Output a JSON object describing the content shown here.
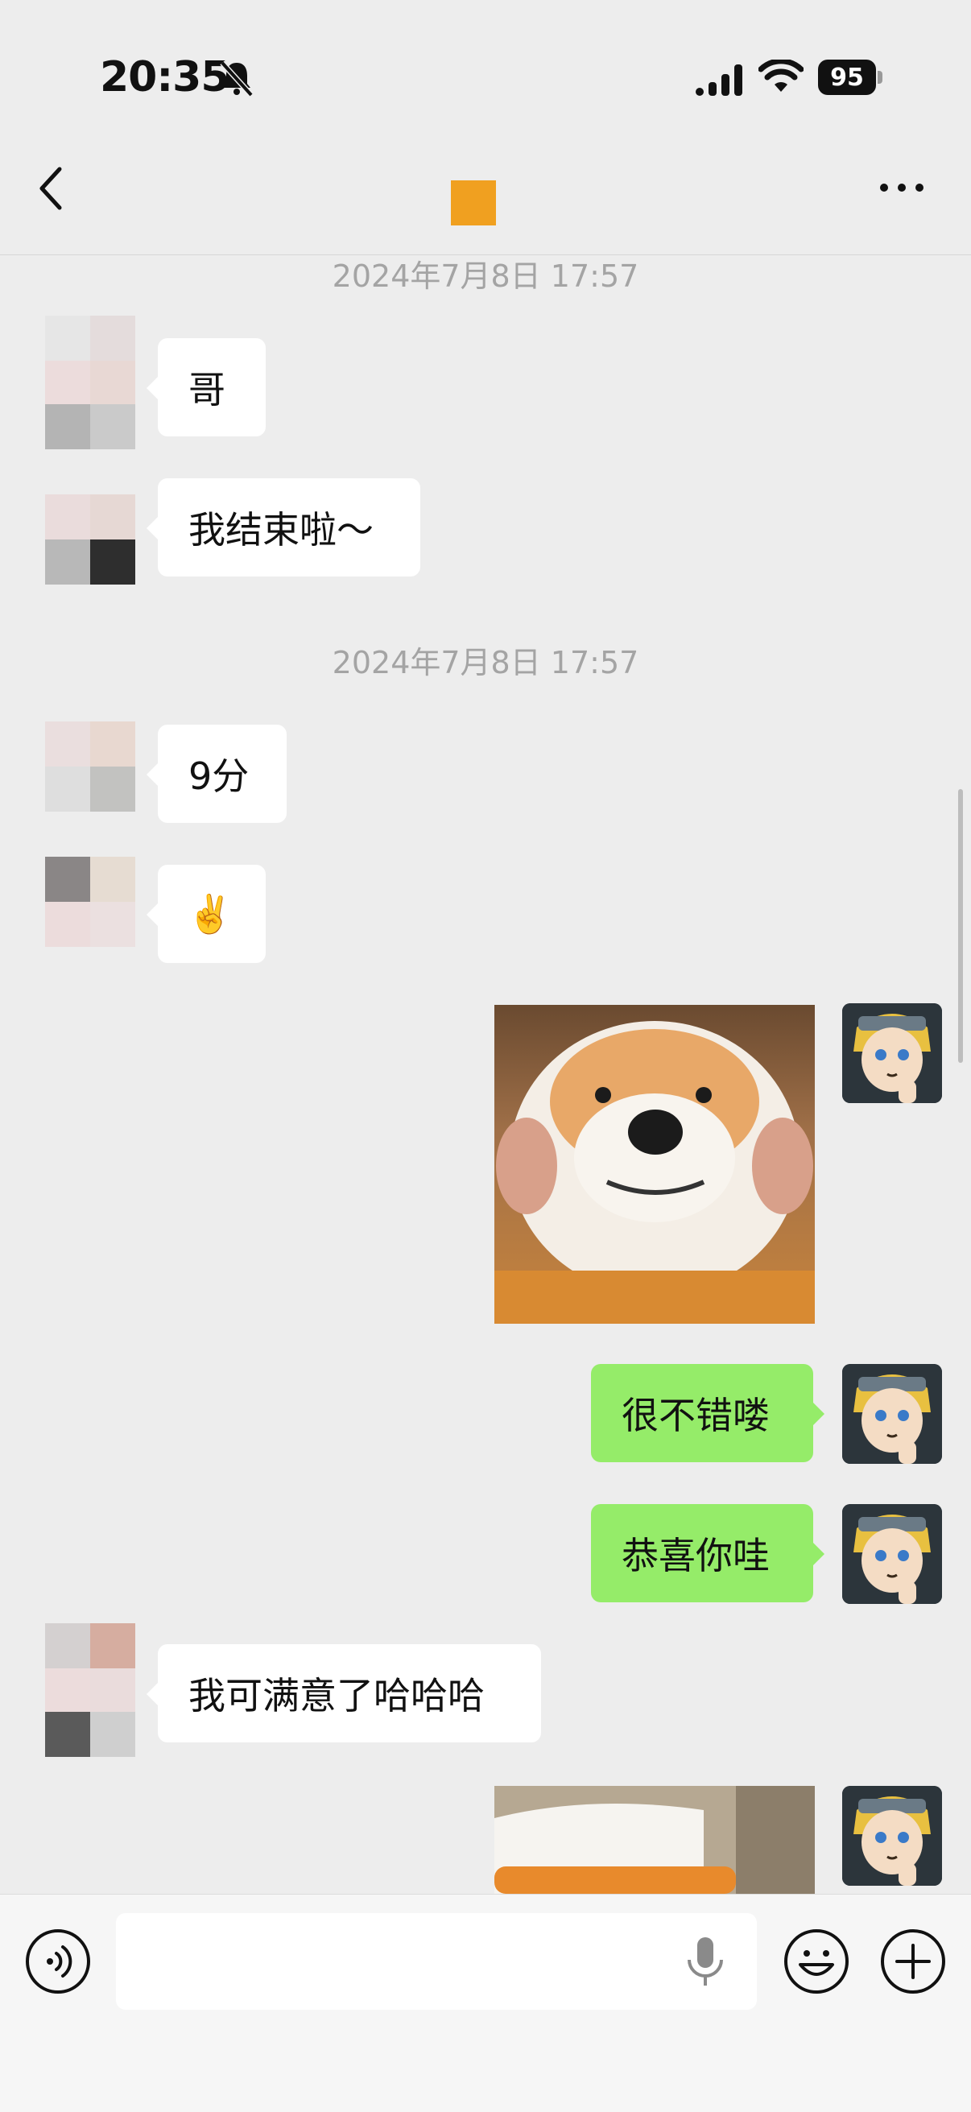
{
  "status_bar": {
    "time": "20:35",
    "battery": "95",
    "icons": [
      "bell-muted-icon",
      "signal-icon",
      "wifi-icon",
      "battery-icon"
    ]
  },
  "nav": {
    "back_icon": "chevron-left-icon",
    "more_icon": "more-dots-icon",
    "title_accent": "#f0a020"
  },
  "messages": {
    "ts1": "2024年7月8日 17:57",
    "m1": "哥",
    "m2": "我结束啦～",
    "ts2": "2024年7月8日 17:57",
    "m3": "9分",
    "m4": "✌️",
    "m5": "很不错喽",
    "m6": "恭喜你哇",
    "m7": "我可满意了哈哈哈"
  },
  "input_bar": {
    "placeholder": "",
    "icons": [
      "voice-icon",
      "microphone-icon",
      "emoji-icon",
      "plus-icon"
    ]
  },
  "colors": {
    "background": "#ededed",
    "outgoing_bubble": "#95ec69",
    "incoming_bubble": "#ffffff",
    "timestamp": "#a4a4a4"
  }
}
